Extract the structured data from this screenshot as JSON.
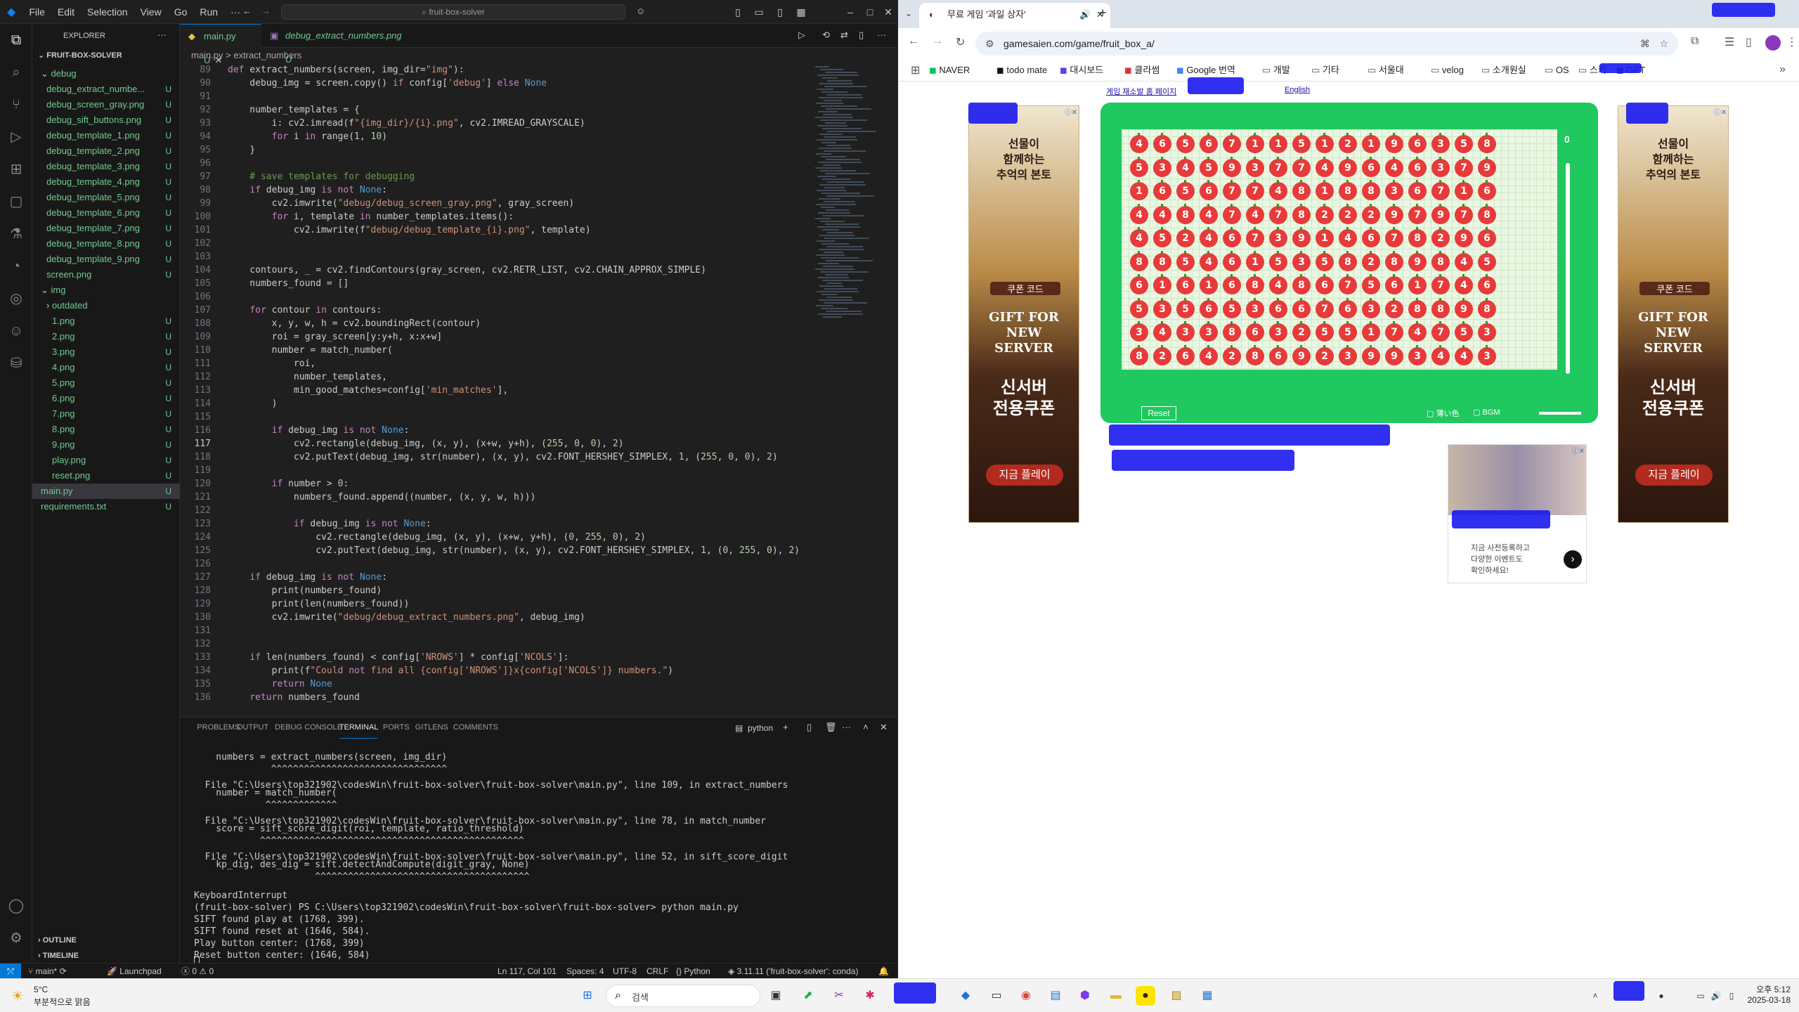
{
  "vscode": {
    "title_search": "fruit-box-solver",
    "menu": [
      "File",
      "Edit",
      "Selection",
      "View",
      "Go",
      "Run",
      "···"
    ],
    "explorer_title": "EXPLORER",
    "project": "FRUIT-BOX-SOLVER",
    "tree": [
      {
        "label": "debug",
        "kind": "folder",
        "status": ""
      },
      {
        "label": "debug_extract_numbe...",
        "kind": "file",
        "status": "U"
      },
      {
        "label": "debug_screen_gray.png",
        "kind": "file",
        "status": "U"
      },
      {
        "label": "debug_sift_buttons.png",
        "kind": "file",
        "status": "U"
      },
      {
        "label": "debug_template_1.png",
        "kind": "file",
        "status": "U"
      },
      {
        "label": "debug_template_2.png",
        "kind": "file",
        "status": "U"
      },
      {
        "label": "debug_template_3.png",
        "kind": "file",
        "status": "U"
      },
      {
        "label": "debug_template_4.png",
        "kind": "file",
        "status": "U"
      },
      {
        "label": "debug_template_5.png",
        "kind": "file",
        "status": "U"
      },
      {
        "label": "debug_template_6.png",
        "kind": "file",
        "status": "U"
      },
      {
        "label": "debug_template_7.png",
        "kind": "file",
        "status": "U"
      },
      {
        "label": "debug_template_8.png",
        "kind": "file",
        "status": "U"
      },
      {
        "label": "debug_template_9.png",
        "kind": "file",
        "status": "U"
      },
      {
        "label": "screen.png",
        "kind": "file",
        "status": "U"
      },
      {
        "label": "img",
        "kind": "folder",
        "status": ""
      },
      {
        "label": "outdated",
        "kind": "folder",
        "status": ""
      },
      {
        "label": "1.png",
        "kind": "file",
        "status": "U"
      },
      {
        "label": "2.png",
        "kind": "file",
        "status": "U"
      },
      {
        "label": "3.png",
        "kind": "file",
        "status": "U"
      },
      {
        "label": "4.png",
        "kind": "file",
        "status": "U"
      },
      {
        "label": "5.png",
        "kind": "file",
        "status": "U"
      },
      {
        "label": "6.png",
        "kind": "file",
        "status": "U"
      },
      {
        "label": "7.png",
        "kind": "file",
        "status": "U"
      },
      {
        "label": "8.png",
        "kind": "file",
        "status": "U"
      },
      {
        "label": "9.png",
        "kind": "file",
        "status": "U"
      },
      {
        "label": "play.png",
        "kind": "file",
        "status": "U"
      },
      {
        "label": "reset.png",
        "kind": "file",
        "status": "U"
      },
      {
        "label": "main.py",
        "kind": "file",
        "status": "U"
      },
      {
        "label": "requirements.txt",
        "kind": "file",
        "status": "U"
      }
    ],
    "outline": "OUTLINE",
    "timeline": "TIMELINE",
    "tabs": [
      {
        "label": "main.py",
        "status": "U"
      },
      {
        "label": "debug_extract_numbers.png",
        "status": "U"
      }
    ],
    "breadcrumb": "main.py > extract_numbers",
    "code": [
      {
        "n": "89",
        "t": "def extract_numbers(screen, img_dir=\"img\"):"
      },
      {
        "n": "90",
        "t": "    debug_img = screen.copy() if config['debug'] else None"
      },
      {
        "n": "91",
        "t": ""
      },
      {
        "n": "92",
        "t": "    number_templates = {"
      },
      {
        "n": "93",
        "t": "        i: cv2.imread(f\"{img_dir}/{i}.png\", cv2.IMREAD_GRAYSCALE)"
      },
      {
        "n": "94",
        "t": "        for i in range(1, 10)"
      },
      {
        "n": "95",
        "t": "    }"
      },
      {
        "n": "96",
        "t": ""
      },
      {
        "n": "97",
        "t": "    # save templates for debugging"
      },
      {
        "n": "98",
        "t": "    if debug_img is not None:"
      },
      {
        "n": "99",
        "t": "        cv2.imwrite(\"debug/debug_screen_gray.png\", gray_screen)"
      },
      {
        "n": "100",
        "t": "        for i, template in number_templates.items():"
      },
      {
        "n": "101",
        "t": "            cv2.imwrite(f\"debug/debug_template_{i}.png\", template)"
      },
      {
        "n": "102",
        "t": ""
      },
      {
        "n": "103",
        "t": ""
      },
      {
        "n": "104",
        "t": "    contours, _ = cv2.findContours(gray_screen, cv2.RETR_LIST, cv2.CHAIN_APPROX_SIMPLE)"
      },
      {
        "n": "105",
        "t": "    numbers_found = []"
      },
      {
        "n": "106",
        "t": ""
      },
      {
        "n": "107",
        "t": "    for contour in contours:"
      },
      {
        "n": "108",
        "t": "        x, y, w, h = cv2.boundingRect(contour)"
      },
      {
        "n": "109",
        "t": "        roi = gray_screen[y:y+h, x:x+w]"
      },
      {
        "n": "110",
        "t": "        number = match_number("
      },
      {
        "n": "111",
        "t": "            roi,"
      },
      {
        "n": "112",
        "t": "            number_templates,"
      },
      {
        "n": "113",
        "t": "            min_good_matches=config['min_matches'],"
      },
      {
        "n": "114",
        "t": "        )"
      },
      {
        "n": "115",
        "t": ""
      },
      {
        "n": "116",
        "t": "        if debug_img is not None:"
      },
      {
        "n": "117",
        "t": "            cv2.rectangle(debug_img, (x, y), (x+w, y+h), (255, 0, 0), 2)"
      },
      {
        "n": "118",
        "t": "            cv2.putText(debug_img, str(number), (x, y), cv2.FONT_HERSHEY_SIMPLEX, 1, (255, 0, 0), 2)"
      },
      {
        "n": "119",
        "t": ""
      },
      {
        "n": "120",
        "t": "        if number > 0:"
      },
      {
        "n": "121",
        "t": "            numbers_found.append((number, (x, y, w, h)))"
      },
      {
        "n": "122",
        "t": ""
      },
      {
        "n": "123",
        "t": "            if debug_img is not None:"
      },
      {
        "n": "124",
        "t": "                cv2.rectangle(debug_img, (x, y), (x+w, y+h), (0, 255, 0), 2)"
      },
      {
        "n": "125",
        "t": "                cv2.putText(debug_img, str(number), (x, y), cv2.FONT_HERSHEY_SIMPLEX, 1, (0, 255, 0), 2)"
      },
      {
        "n": "126",
        "t": ""
      },
      {
        "n": "127",
        "t": "    if debug_img is not None:"
      },
      {
        "n": "128",
        "t": "        print(numbers_found)"
      },
      {
        "n": "129",
        "t": "        print(len(numbers_found))"
      },
      {
        "n": "130",
        "t": "        cv2.imwrite(\"debug/debug_extract_numbers.png\", debug_img)"
      },
      {
        "n": "131",
        "t": ""
      },
      {
        "n": "132",
        "t": ""
      },
      {
        "n": "133",
        "t": "    if len(numbers_found) < config['NROWS'] * config['NCOLS']:"
      },
      {
        "n": "134",
        "t": "        print(f\"Could not find all {config['NROWS']}x{config['NCOLS']} numbers.\")"
      },
      {
        "n": "135",
        "t": "        return None"
      },
      {
        "n": "136",
        "t": "    return numbers_found"
      }
    ],
    "panel_tabs": [
      "PROBLEMS",
      "OUTPUT",
      "DEBUG CONSOLE",
      "TERMINAL",
      "PORTS",
      "GITLENS",
      "COMMENTS"
    ],
    "terminal_shell": "python",
    "terminal": [
      "    numbers = extract_numbers(screen, img_dir)",
      "              ^^^^^^^^^^^^^^^^^^^^^^^^^^^^^^^^",
      "  File \"C:\\Users\\top321902\\codesWin\\fruit-box-solver\\fruit-box-solver\\main.py\", line 109, in extract_numbers",
      "    number = match_number(",
      "             ^^^^^^^^^^^^^",
      "  File \"C:\\Users\\top321902\\codesWin\\fruit-box-solver\\fruit-box-solver\\main.py\", line 78, in match_number",
      "    score = sift_score_digit(roi, template, ratio_threshold)",
      "            ^^^^^^^^^^^^^^^^^^^^^^^^^^^^^^^^^^^^^^^^^^^^^^^^",
      "  File \"C:\\Users\\top321902\\codesWin\\fruit-box-solver\\fruit-box-solver\\main.py\", line 52, in sift_score_digit",
      "    kp_dig, des_dig = sift.detectAndCompute(digit_gray, None)",
      "                      ^^^^^^^^^^^^^^^^^^^^^^^^^^^^^^^^^^^^^^^",
      "KeyboardInterrupt",
      "(fruit-box-solver) PS C:\\Users\\top321902\\codesWin\\fruit-box-solver\\fruit-box-solver> python main.py",
      "SIFT found play at (1768, 399).",
      "SIFT found reset at (1646, 584).",
      "Play button center: (1768, 399)",
      "Reset button center: (1646, 584)"
    ],
    "status": {
      "branch": "main*",
      "launch": "Launchpad",
      "errors": "0",
      "warnings": "0",
      "position": "Ln 117, Col 101",
      "spaces": "Spaces: 4",
      "encoding": "UTF-8",
      "eol": "CRLF",
      "lang": "Python",
      "interpreter": "3.11.11 ('fruit-box-solver': conda)"
    }
  },
  "chrome": {
    "tab_title": "무료 게임 '과일 상자'",
    "url": "gamesaien.com/game/fruit_box_a/",
    "bookmarks": [
      "NAVER",
      "todo mate",
      "대시보드",
      "클라썸",
      "Google 번역",
      "개발",
      "기타",
      "서울대",
      "velog",
      "소개원실",
      "OS",
      "스키",
      "GPT"
    ],
    "links": {
      "left": "게임 재소발 홈 페이지",
      "en": "English"
    },
    "ad_lines": [
      "선물이",
      "함께하는",
      "추억의 본토",
      "쿠폰 코드",
      "GIFT FOR",
      "NEW",
      "SERVER",
      "신서버",
      "전용쿠폰",
      "지금 플레이"
    ],
    "ad2_lines": [
      "지금 사전등록하고",
      "다양한 이벤트도",
      "확인하세요!"
    ],
    "game": {
      "score": "0",
      "reset": "Reset",
      "light": "薄い色",
      "bgm": "BGM",
      "grid": [
        "4656711512196358",
        "5345937749646379",
        "1656774818836716",
        "4484747822297978",
        "4524673914678296",
        "8854615358289845",
        "6161684867561746",
        "5356536676328898",
        "3433863255174753",
        "8264286923993443"
      ]
    }
  },
  "taskbar": {
    "weather_temp": "5°C",
    "weather_desc": "부분적으로 맑음",
    "search": "검색",
    "time": "오후 5:12",
    "date": "2025-03-18"
  },
  "colors": {
    "vs_bg": "#1f1f1f",
    "accent": "#0078d4",
    "apple": "#e83a3a",
    "board_border": "#20c860",
    "untracked": "#73c991"
  }
}
